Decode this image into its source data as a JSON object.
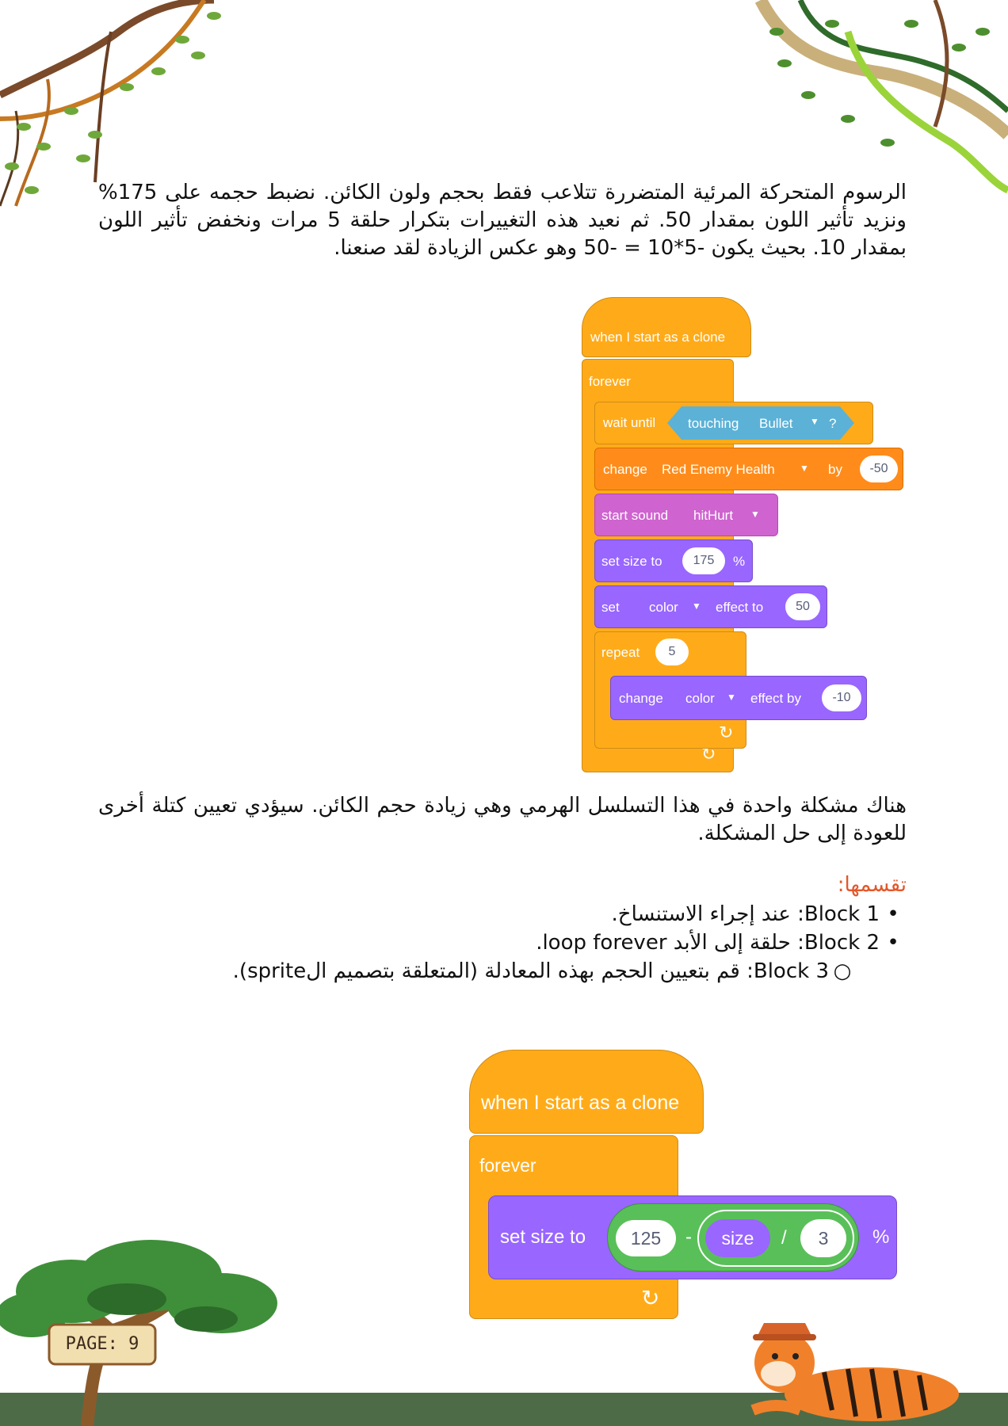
{
  "paragraph1": "الرسوم المتحركة المرئية المتضررة تتلاعب فقط بحجم ولون الكائن. نضبط حجمه على 175% ونزيد تأثير اللون بمقدار 50. ثم نعيد هذه التغييرات بتكرار حلقة 5 مرات ونخفض تأثير اللون بمقدار 10. بحيث يكون -5*10 = -50 وهو عكس الزيادة لقد صنعنا.",
  "paragraph2": "هناك مشكلة واحدة في هذا التسلسل الهرمي وهي زيادة حجم الكائن. سيؤدي تعيين كتلة أخرى للعودة إلى حل المشكلة.",
  "division_heading": "تقسمها:",
  "list_items": [
    {
      "bullet": "•",
      "text": "Block 1: عند إجراء الاستنساخ."
    },
    {
      "bullet": "•",
      "text": "Block 2: حلقة إلى الأبد loop forever."
    },
    {
      "bullet": "○",
      "text": "Block 3: قم بتعيين الحجم بهذه المعادلة (المتعلقة بتصميم الsprite)."
    }
  ],
  "script1": {
    "hat": "when I start as a clone",
    "forever": "forever",
    "wait_until": "wait until",
    "touching": "touching",
    "touching_target": "Bullet",
    "question": "?",
    "change_var": "change",
    "variable": "Red Enemy Health",
    "by": "by",
    "change_value": "-50",
    "start_sound": "start sound",
    "sound": "hitHurt",
    "set_size": "set size to",
    "size_value": "175",
    "percent": "%",
    "set": "set",
    "effect1": "color",
    "effect_to": "effect to",
    "effect_value": "50",
    "repeat": "repeat",
    "repeat_count": "5",
    "change_effect": "change",
    "effect2": "color",
    "effect_by": "effect by",
    "effect_change": "-10",
    "loop_arrow": "↻"
  },
  "script2": {
    "hat": "when I start as a clone",
    "forever": "forever",
    "set_size": "set size to",
    "a": "125",
    "minus": "-",
    "size": "size",
    "divide": "/",
    "b": "3",
    "percent": "%",
    "loop_arrow": "↻"
  },
  "page_label": "PAGE: 9",
  "colors": {
    "motion": "#ffab19",
    "looks": "#9966ff",
    "sound": "#cf63cf",
    "sensing": "#5cb1d6",
    "variables": "#ff8c1a",
    "operators": "#59c059",
    "heading": "#e3572a",
    "ground": "#4e6b48"
  }
}
